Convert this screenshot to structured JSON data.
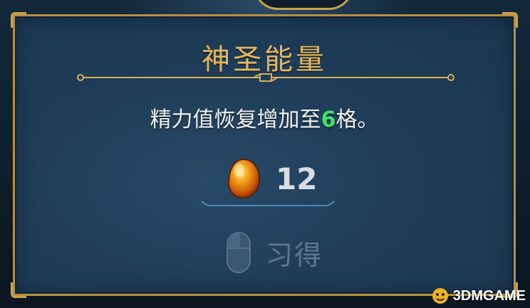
{
  "dialog": {
    "title": "神圣能量",
    "description_before": "精力值恢复增加至",
    "description_highlight": "6",
    "description_after": "格。",
    "cost": {
      "icon": "amber-gem-icon",
      "value": "12"
    },
    "learn_button": {
      "icon": "mouse-icon",
      "label": "习得"
    }
  },
  "watermark": {
    "text": "3DMGAME"
  },
  "colors": {
    "gold_border": "#b78f3e",
    "title": "#e6b65c",
    "highlight_green": "#3fe36a",
    "panel_blue": "#1f3d58",
    "disabled_text": "#5b7791"
  }
}
